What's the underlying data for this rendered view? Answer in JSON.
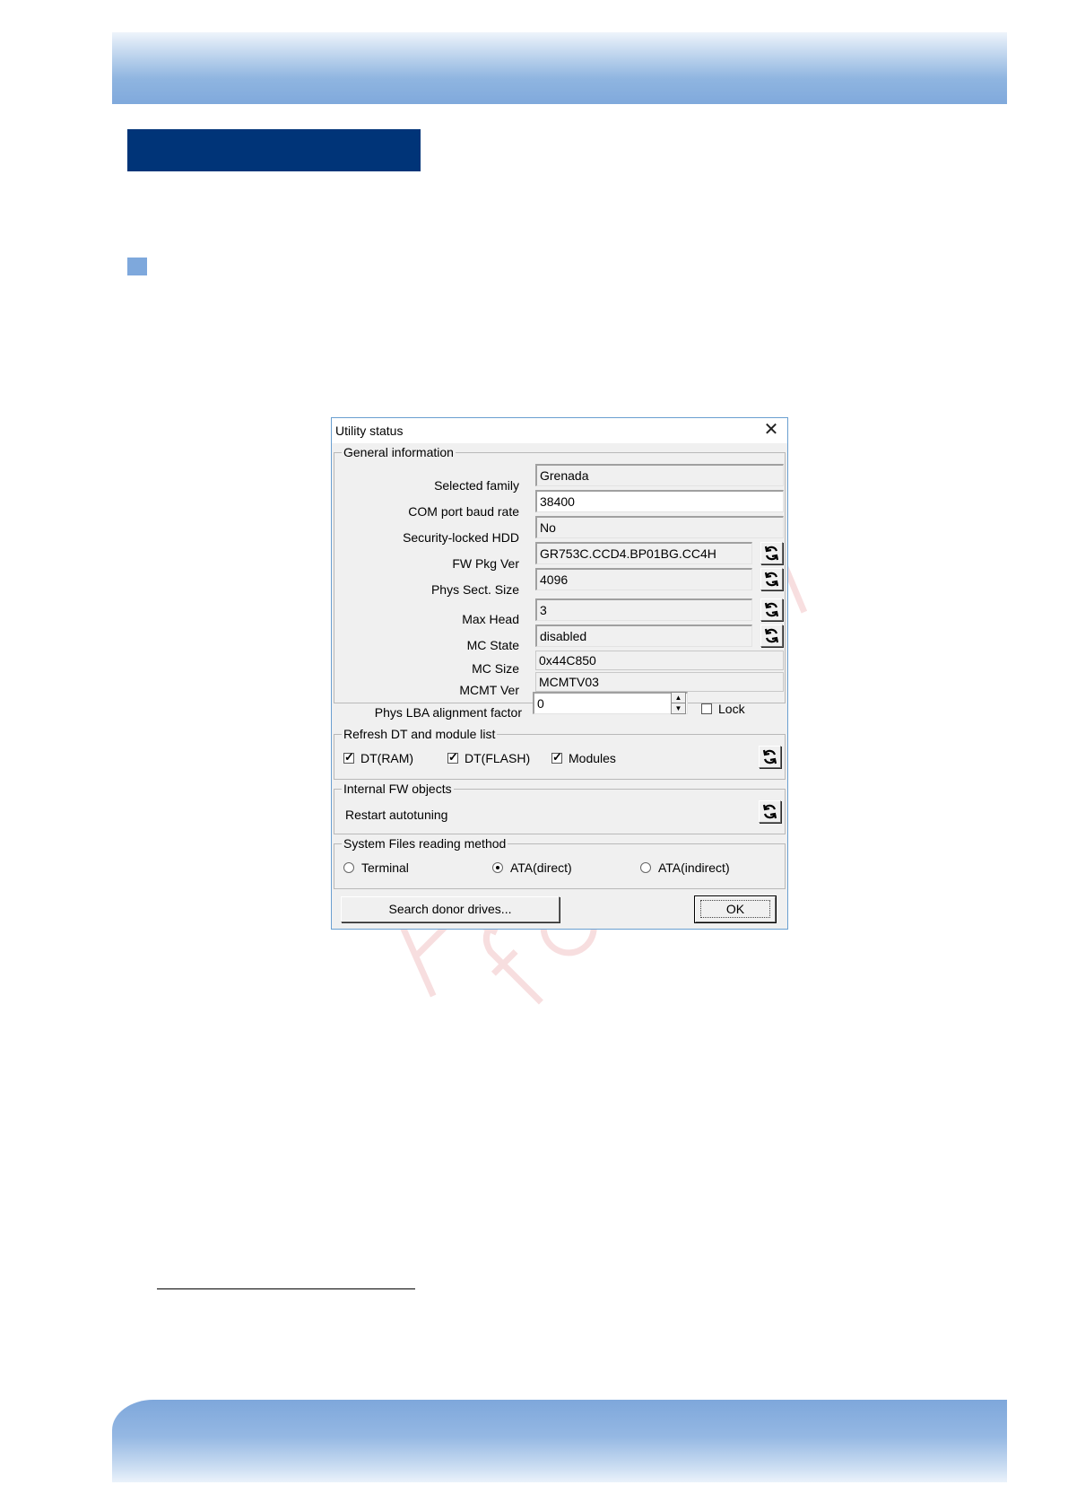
{
  "dialog": {
    "title": "Utility status",
    "general": {
      "legend": "General information",
      "selected_family_label": "Selected family",
      "selected_family_value": "Grenada",
      "baud_label": "COM port baud rate",
      "baud_value": "38400",
      "security_label": "Security-locked HDD",
      "security_value": "No",
      "fw_label": "FW Pkg Ver",
      "fw_value": "GR753C.CCD4.BP01BG.CC4H",
      "phys_sect_label": "Phys Sect. Size",
      "phys_sect_value": "4096",
      "max_head_label": "Max Head",
      "max_head_value": "3",
      "mc_state_label": "MC State",
      "mc_state_value": "disabled",
      "mc_size_label": "MC Size",
      "mc_size_value": "0x44C850",
      "mcmt_label": "MCMT Ver",
      "mcmt_value": "MCMTV03",
      "lba_label": "Phys LBA alignment factor",
      "lba_value": "0",
      "lock_label": "Lock",
      "lock_checked": false
    },
    "refresh": {
      "legend": "Refresh DT and module list",
      "dt_ram_label": "DT(RAM)",
      "dt_ram_checked": true,
      "dt_flash_label": "DT(FLASH)",
      "dt_flash_checked": true,
      "modules_label": "Modules",
      "modules_checked": true
    },
    "internal": {
      "legend": "Internal FW objects",
      "restart_label": "Restart autotuning"
    },
    "sysfiles": {
      "legend": "System Files reading method",
      "terminal_label": "Terminal",
      "ata_direct_label": "ATA(direct)",
      "ata_indirect_label": "ATA(indirect)",
      "selected": "ATA(direct)"
    },
    "buttons": {
      "search_label": "Search donor drives...",
      "ok_label": "OK"
    }
  },
  "icons": {
    "close": "close-icon",
    "refresh": "refresh-icon",
    "spin_up": "spin-up-icon",
    "spin_down": "spin-down-icon"
  },
  "colors": {
    "header_blue": "#80a9dc",
    "title_block_navy": "#003478",
    "dialog_border": "#6a9fd0"
  }
}
